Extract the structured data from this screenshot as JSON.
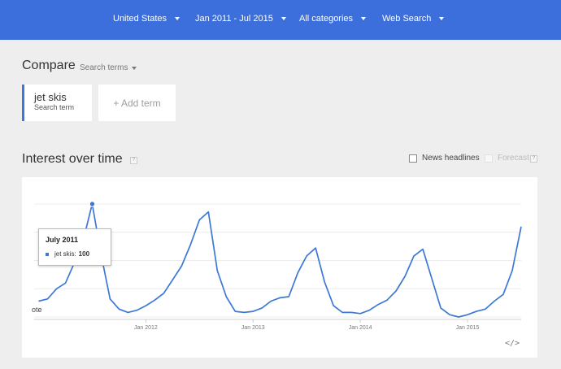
{
  "topbar": {
    "filters": [
      {
        "label": "United States",
        "icon": "chevron-down-icon"
      },
      {
        "label": "Jan 2011 - Jul 2015",
        "icon": "chevron-down-icon"
      },
      {
        "label": "All categories",
        "icon": "chevron-down-icon"
      },
      {
        "label": "Web Search",
        "icon": "chevron-down-icon"
      }
    ]
  },
  "compare": {
    "title": "Compare",
    "dropdown_label": "Search terms",
    "term": {
      "name": "jet skis",
      "subtitle": "Search term"
    },
    "add_term_label": "+ Add term"
  },
  "interest": {
    "title": "Interest over time",
    "help_glyph": "?",
    "news_label": "News headlines",
    "forecast_label": "Forecast",
    "embed_label": "</>",
    "note_label": "ote"
  },
  "tooltip": {
    "title": "July 2011",
    "series_label": "jet skis:",
    "value": "100"
  },
  "colors": {
    "topbar": "#3c6fdb",
    "series": "#3c78d8"
  },
  "chart_data": {
    "type": "line",
    "title": "",
    "xlabel": "",
    "ylabel": "",
    "ylim": [
      0,
      100
    ],
    "grid": true,
    "x_ticks": [
      "Jan 2012",
      "Jan 2013",
      "Jan 2014",
      "Jan 2015"
    ],
    "x": [
      "2011-01",
      "2011-02",
      "2011-03",
      "2011-04",
      "2011-05",
      "2011-06",
      "2011-07",
      "2011-08",
      "2011-09",
      "2011-10",
      "2011-11",
      "2011-12",
      "2012-01",
      "2012-02",
      "2012-03",
      "2012-04",
      "2012-05",
      "2012-06",
      "2012-07",
      "2012-08",
      "2012-09",
      "2012-10",
      "2012-11",
      "2012-12",
      "2013-01",
      "2013-02",
      "2013-03",
      "2013-04",
      "2013-05",
      "2013-06",
      "2013-07",
      "2013-08",
      "2013-09",
      "2013-10",
      "2013-11",
      "2013-12",
      "2014-01",
      "2014-02",
      "2014-03",
      "2014-04",
      "2014-05",
      "2014-06",
      "2014-07",
      "2014-08",
      "2014-09",
      "2014-10",
      "2014-11",
      "2014-12",
      "2015-01",
      "2015-02",
      "2015-03",
      "2015-04",
      "2015-05",
      "2015-06",
      "2015-07"
    ],
    "series": [
      {
        "name": "jet skis",
        "values": [
          14,
          16,
          25,
          30,
          48,
          68,
          100,
          55,
          16,
          7,
          4,
          6,
          10,
          15,
          21,
          33,
          45,
          64,
          86,
          93,
          41,
          18,
          5,
          4,
          5,
          8,
          14,
          17,
          18,
          39,
          54,
          61,
          31,
          10,
          4,
          4,
          3,
          6,
          11,
          15,
          23,
          36,
          54,
          60,
          34,
          8,
          2,
          0,
          2,
          5,
          7,
          14,
          20,
          41,
          80
        ]
      }
    ]
  }
}
